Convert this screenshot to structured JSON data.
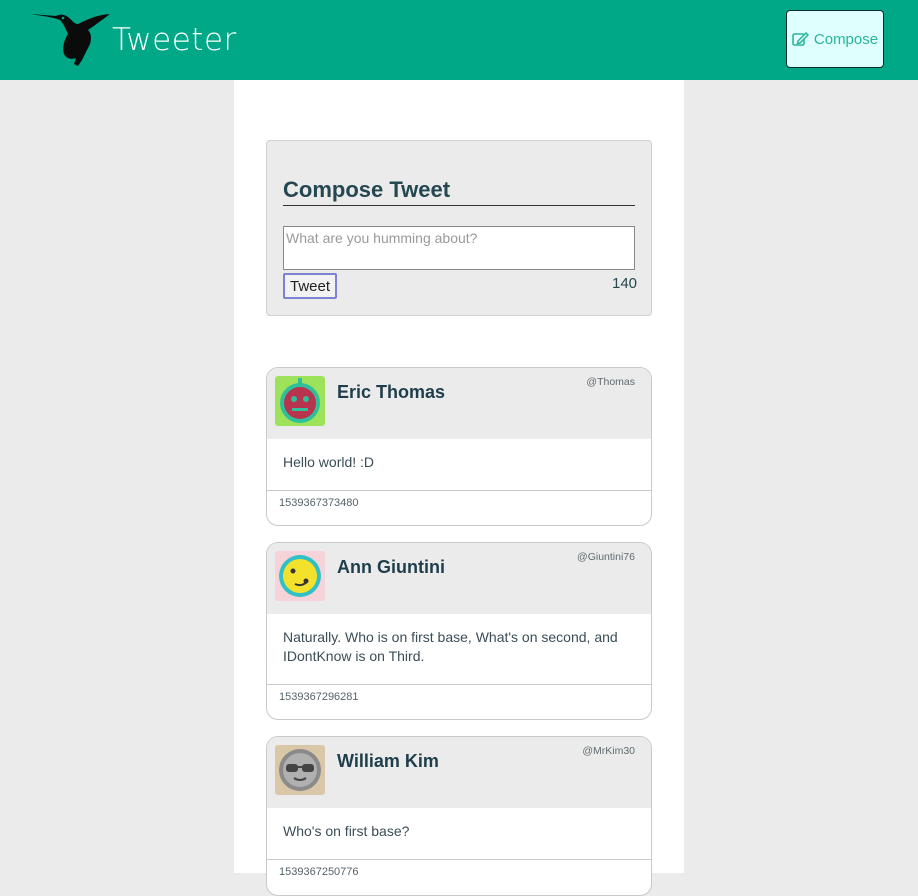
{
  "nav": {
    "brand": "Tweeter",
    "compose_label": "Compose"
  },
  "composer": {
    "title": "Compose Tweet",
    "placeholder": "What are you humming about?",
    "tweet_label": "Tweet",
    "counter": "140"
  },
  "tweets": [
    {
      "name": "Eric Thomas",
      "handle": "@Thomas",
      "content": "Hello world! :D",
      "timestamp": "1539367373480",
      "avatar_icon": "robot-face-icon",
      "avatar_bg": "#9ee15a"
    },
    {
      "name": "Ann Giuntini",
      "handle": "@Giuntini76",
      "content": "Naturally. Who is on first base, What's on second, and IDontKnow is on Third.",
      "timestamp": "1539367296281",
      "avatar_icon": "smiley-face-icon",
      "avatar_bg": "#f6d2d9"
    },
    {
      "name": "William Kim",
      "handle": "@MrKim30",
      "content": "Who's on first base?",
      "timestamp": "1539367250776",
      "avatar_icon": "sunglasses-face-icon",
      "avatar_bg": "#d9c7a8"
    }
  ],
  "colors": {
    "nav_bg": "#00a887",
    "page_bg": "#ebebeb",
    "name_color": "#1f3d4a"
  }
}
